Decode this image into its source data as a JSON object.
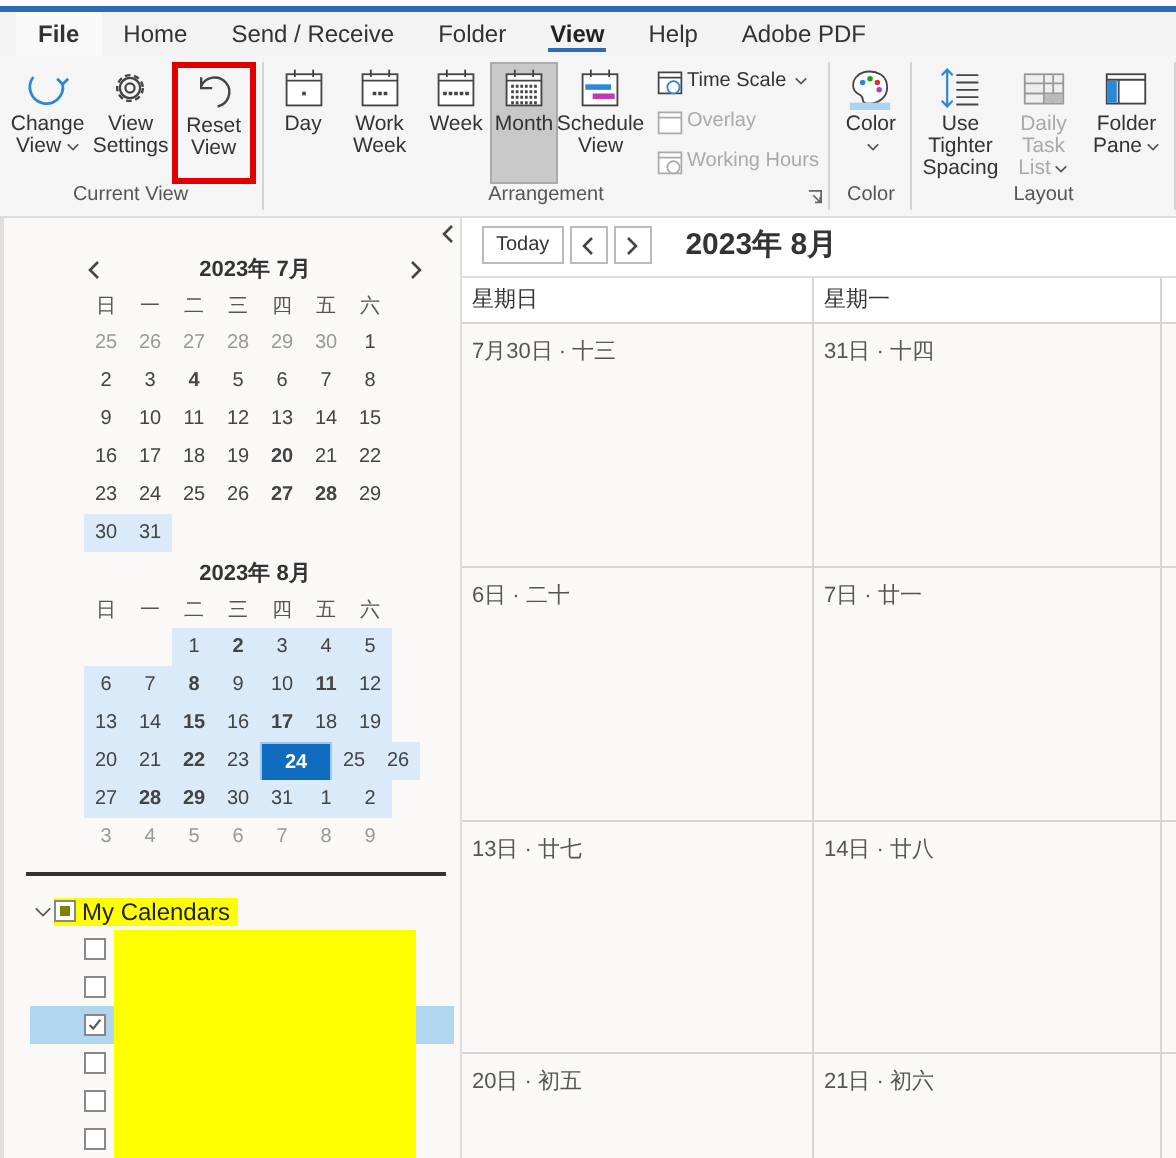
{
  "tabs": [
    {
      "label": "File",
      "selected": false
    },
    {
      "label": "Home",
      "selected": false
    },
    {
      "label": "Send / Receive",
      "selected": false
    },
    {
      "label": "Folder",
      "selected": false
    },
    {
      "label": "View",
      "selected": true
    },
    {
      "label": "Help",
      "selected": false
    },
    {
      "label": "Adobe PDF",
      "selected": false
    }
  ],
  "ribbon": [
    {
      "label": "Current View",
      "launcher": false,
      "buttons": [
        {
          "kind": "large",
          "label": "Change View",
          "dropdown": true,
          "selected": false,
          "disabled": false,
          "highlighted": false
        },
        {
          "kind": "large",
          "label": "View Settings",
          "dropdown": false,
          "selected": false,
          "disabled": false,
          "highlighted": false
        },
        {
          "kind": "large",
          "label": "Reset View",
          "dropdown": false,
          "selected": false,
          "disabled": false,
          "highlighted": true
        }
      ]
    },
    {
      "label": "Arrangement",
      "launcher": true,
      "buttons": [
        {
          "kind": "large",
          "label": "Day",
          "dropdown": false,
          "selected": false,
          "disabled": false,
          "highlighted": false
        },
        {
          "kind": "large",
          "label": "Work Week",
          "dropdown": false,
          "selected": false,
          "disabled": false,
          "highlighted": false
        },
        {
          "kind": "large",
          "label": "Week",
          "dropdown": false,
          "selected": false,
          "disabled": false,
          "highlighted": false
        },
        {
          "kind": "large",
          "label": "Month",
          "dropdown": false,
          "selected": true,
          "disabled": false,
          "highlighted": false
        },
        {
          "kind": "large",
          "label": "Schedule View",
          "dropdown": false,
          "selected": false,
          "disabled": false,
          "highlighted": false
        },
        {
          "kind": "small",
          "label": "Time Scale",
          "dropdown": true,
          "selected": false,
          "disabled": false,
          "highlighted": false
        },
        {
          "kind": "small",
          "label": "Overlay",
          "dropdown": false,
          "selected": false,
          "disabled": true,
          "highlighted": false
        },
        {
          "kind": "small",
          "label": "Working Hours",
          "dropdown": false,
          "selected": false,
          "disabled": true,
          "highlighted": false
        }
      ]
    },
    {
      "label": "Color",
      "launcher": false,
      "buttons": [
        {
          "kind": "large",
          "label": "Color",
          "dropdown": true,
          "selected": false,
          "disabled": false,
          "highlighted": false
        }
      ]
    },
    {
      "label": "Layout",
      "launcher": false,
      "buttons": [
        {
          "kind": "large",
          "label": "Use Tighter Spacing",
          "dropdown": false,
          "selected": false,
          "disabled": false,
          "highlighted": false
        },
        {
          "kind": "large",
          "label": "Daily Task List",
          "dropdown": true,
          "selected": false,
          "disabled": true,
          "highlighted": false
        },
        {
          "kind": "large",
          "label": "Folder Pane",
          "dropdown": true,
          "selected": false,
          "disabled": false,
          "highlighted": false
        }
      ]
    }
  ],
  "mini_calendars": [
    {
      "title": "2023年 7月",
      "weekdays": [
        "日",
        "一",
        "二",
        "三",
        "四",
        "五",
        "六"
      ],
      "weeks": [
        [
          {
            "kind": "day",
            "day": "25",
            "other": true,
            "bold": false,
            "selected": false,
            "today": false
          },
          {
            "kind": "day",
            "day": "26",
            "other": true,
            "bold": false,
            "selected": false,
            "today": false
          },
          {
            "kind": "day",
            "day": "27",
            "other": true,
            "bold": false,
            "selected": false,
            "today": false
          },
          {
            "kind": "day",
            "day": "28",
            "other": true,
            "bold": false,
            "selected": false,
            "today": false
          },
          {
            "kind": "day",
            "day": "29",
            "other": true,
            "bold": false,
            "selected": false,
            "today": false
          },
          {
            "kind": "day",
            "day": "30",
            "other": true,
            "bold": false,
            "selected": false,
            "today": false
          },
          {
            "kind": "day",
            "day": "1",
            "other": false,
            "bold": false,
            "selected": false,
            "today": false
          }
        ],
        [
          {
            "kind": "day",
            "day": "2",
            "other": false,
            "bold": false,
            "selected": false,
            "today": false
          },
          {
            "kind": "day",
            "day": "3",
            "other": false,
            "bold": false,
            "selected": false,
            "today": false
          },
          {
            "kind": "day",
            "day": "4",
            "other": false,
            "bold": true,
            "selected": false,
            "today": false
          },
          {
            "kind": "day",
            "day": "5",
            "other": false,
            "bold": false,
            "selected": false,
            "today": false
          },
          {
            "kind": "day",
            "day": "6",
            "other": false,
            "bold": false,
            "selected": false,
            "today": false
          },
          {
            "kind": "day",
            "day": "7",
            "other": false,
            "bold": false,
            "selected": false,
            "today": false
          },
          {
            "kind": "day",
            "day": "8",
            "other": false,
            "bold": false,
            "selected": false,
            "today": false
          }
        ],
        [
          {
            "kind": "day",
            "day": "9",
            "other": false,
            "bold": false,
            "selected": false,
            "today": false
          },
          {
            "kind": "day",
            "day": "10",
            "other": false,
            "bold": false,
            "selected": false,
            "today": false
          },
          {
            "kind": "day",
            "day": "11",
            "other": false,
            "bold": false,
            "selected": false,
            "today": false
          },
          {
            "kind": "day",
            "day": "12",
            "other": false,
            "bold": false,
            "selected": false,
            "today": false
          },
          {
            "kind": "day",
            "day": "13",
            "other": false,
            "bold": false,
            "selected": false,
            "today": false
          },
          {
            "kind": "day",
            "day": "14",
            "other": false,
            "bold": false,
            "selected": false,
            "today": false
          },
          {
            "kind": "day",
            "day": "15",
            "other": false,
            "bold": false,
            "selected": false,
            "today": false
          }
        ],
        [
          {
            "kind": "day",
            "day": "16",
            "other": false,
            "bold": false,
            "selected": false,
            "today": false
          },
          {
            "kind": "day",
            "day": "17",
            "other": false,
            "bold": false,
            "selected": false,
            "today": false
          },
          {
            "kind": "day",
            "day": "18",
            "other": false,
            "bold": false,
            "selected": false,
            "today": false
          },
          {
            "kind": "day",
            "day": "19",
            "other": false,
            "bold": false,
            "selected": false,
            "today": false
          },
          {
            "kind": "day",
            "day": "20",
            "other": false,
            "bold": true,
            "selected": false,
            "today": false
          },
          {
            "kind": "day",
            "day": "21",
            "other": false,
            "bold": false,
            "selected": false,
            "today": false
          },
          {
            "kind": "day",
            "day": "22",
            "other": false,
            "bold": false,
            "selected": false,
            "today": false
          }
        ],
        [
          {
            "kind": "day",
            "day": "23",
            "other": false,
            "bold": false,
            "selected": false,
            "today": false
          },
          {
            "kind": "day",
            "day": "24",
            "other": false,
            "bold": false,
            "selected": false,
            "today": false
          },
          {
            "kind": "day",
            "day": "25",
            "other": false,
            "bold": false,
            "selected": false,
            "today": false
          },
          {
            "kind": "day",
            "day": "26",
            "other": false,
            "bold": false,
            "selected": false,
            "today": false
          },
          {
            "kind": "day",
            "day": "27",
            "other": false,
            "bold": true,
            "selected": false,
            "today": false
          },
          {
            "kind": "day",
            "day": "28",
            "other": false,
            "bold": true,
            "selected": false,
            "today": false
          },
          {
            "kind": "day",
            "day": "29",
            "other": false,
            "bold": false,
            "selected": false,
            "today": false
          }
        ],
        [
          {
            "kind": "day",
            "day": "30",
            "other": false,
            "bold": false,
            "selected": true,
            "today": false
          },
          {
            "kind": "day",
            "day": "31",
            "other": false,
            "bold": false,
            "selected": true,
            "today": false
          }
        ]
      ]
    },
    {
      "title": "2023年 8月",
      "weekdays": [
        "日",
        "一",
        "二",
        "三",
        "四",
        "五",
        "六"
      ],
      "weeks": [
        [
          {
            "kind": "blank"
          },
          {
            "kind": "blank"
          },
          {
            "kind": "day",
            "day": "1",
            "other": false,
            "bold": false,
            "selected": true,
            "today": false
          },
          {
            "kind": "day",
            "day": "2",
            "other": false,
            "bold": true,
            "selected": true,
            "today": false
          },
          {
            "kind": "day",
            "day": "3",
            "other": false,
            "bold": false,
            "selected": true,
            "today": false
          },
          {
            "kind": "day",
            "day": "4",
            "other": false,
            "bold": false,
            "selected": true,
            "today": false
          },
          {
            "kind": "day",
            "day": "5",
            "other": false,
            "bold": false,
            "selected": true,
            "today": false
          }
        ],
        [
          {
            "kind": "day",
            "day": "6",
            "other": false,
            "bold": false,
            "selected": true,
            "today": false
          },
          {
            "kind": "day",
            "day": "7",
            "other": false,
            "bold": false,
            "selected": true,
            "today": false
          },
          {
            "kind": "day",
            "day": "8",
            "other": false,
            "bold": true,
            "selected": true,
            "today": false
          },
          {
            "kind": "day",
            "day": "9",
            "other": false,
            "bold": false,
            "selected": true,
            "today": false
          },
          {
            "kind": "day",
            "day": "10",
            "other": false,
            "bold": false,
            "selected": true,
            "today": false
          },
          {
            "kind": "day",
            "day": "11",
            "other": false,
            "bold": true,
            "selected": true,
            "today": false
          },
          {
            "kind": "day",
            "day": "12",
            "other": false,
            "bold": false,
            "selected": true,
            "today": false
          }
        ],
        [
          {
            "kind": "day",
            "day": "13",
            "other": false,
            "bold": false,
            "selected": true,
            "today": false
          },
          {
            "kind": "day",
            "day": "14",
            "other": false,
            "bold": false,
            "selected": true,
            "today": false
          },
          {
            "kind": "day",
            "day": "15",
            "other": false,
            "bold": true,
            "selected": true,
            "today": false
          },
          {
            "kind": "day",
            "day": "16",
            "other": false,
            "bold": false,
            "selected": true,
            "today": false
          },
          {
            "kind": "day",
            "day": "17",
            "other": false,
            "bold": true,
            "selected": true,
            "today": false
          },
          {
            "kind": "day",
            "day": "18",
            "other": false,
            "bold": false,
            "selected": true,
            "today": false
          },
          {
            "kind": "day",
            "day": "19",
            "other": false,
            "bold": false,
            "selected": true,
            "today": false
          }
        ],
        [
          {
            "kind": "day",
            "day": "20",
            "other": false,
            "bold": false,
            "selected": true,
            "today": false
          },
          {
            "kind": "day",
            "day": "21",
            "other": false,
            "bold": false,
            "selected": true,
            "today": false
          },
          {
            "kind": "day",
            "day": "22",
            "other": false,
            "bold": true,
            "selected": true,
            "today": false
          },
          {
            "kind": "day",
            "day": "23",
            "other": false,
            "bold": false,
            "selected": true,
            "today": false
          },
          {
            "kind": "day",
            "day": "24",
            "other": false,
            "bold": true,
            "selected": true,
            "today": true
          },
          {
            "kind": "day",
            "day": "25",
            "other": false,
            "bold": false,
            "selected": true,
            "today": false
          },
          {
            "kind": "day",
            "day": "26",
            "other": false,
            "bold": false,
            "selected": true,
            "today": false
          }
        ],
        [
          {
            "kind": "day",
            "day": "27",
            "other": false,
            "bold": false,
            "selected": true,
            "today": false
          },
          {
            "kind": "day",
            "day": "28",
            "other": false,
            "bold": true,
            "selected": true,
            "today": false
          },
          {
            "kind": "day",
            "day": "29",
            "other": false,
            "bold": true,
            "selected": true,
            "today": false
          },
          {
            "kind": "day",
            "day": "30",
            "other": false,
            "bold": false,
            "selected": true,
            "today": false
          },
          {
            "kind": "day",
            "day": "31",
            "other": false,
            "bold": false,
            "selected": true,
            "today": false
          },
          {
            "kind": "day",
            "day": "1",
            "other": false,
            "bold": false,
            "selected": true,
            "today": false
          },
          {
            "kind": "day",
            "day": "2",
            "other": false,
            "bold": false,
            "selected": true,
            "today": false
          }
        ],
        [
          {
            "kind": "day",
            "day": "3",
            "other": true,
            "bold": false,
            "selected": false,
            "today": false
          },
          {
            "kind": "day",
            "day": "4",
            "other": true,
            "bold": false,
            "selected": false,
            "today": false
          },
          {
            "kind": "day",
            "day": "5",
            "other": true,
            "bold": false,
            "selected": false,
            "today": false
          },
          {
            "kind": "day",
            "day": "6",
            "other": true,
            "bold": false,
            "selected": false,
            "today": false
          },
          {
            "kind": "day",
            "day": "7",
            "other": true,
            "bold": false,
            "selected": false,
            "today": false
          },
          {
            "kind": "day",
            "day": "8",
            "other": true,
            "bold": false,
            "selected": false,
            "today": false
          },
          {
            "kind": "day",
            "day": "9",
            "other": true,
            "bold": false,
            "selected": false,
            "today": false
          }
        ]
      ]
    }
  ],
  "calendar_tree": {
    "label": "My Calendars",
    "expanded": true,
    "partial": true,
    "highlighted": true,
    "items": [
      {
        "checked": false,
        "selected": false,
        "redacted": true
      },
      {
        "checked": false,
        "selected": false,
        "redacted": true
      },
      {
        "checked": true,
        "selected": true,
        "redacted": true
      },
      {
        "checked": false,
        "selected": false,
        "redacted": true
      },
      {
        "checked": false,
        "selected": false,
        "redacted": true
      },
      {
        "checked": false,
        "selected": false,
        "redacted": true
      }
    ]
  },
  "calendar": {
    "today_button": "Today",
    "title": "2023年 8月",
    "columns": [
      "星期日",
      "星期一"
    ],
    "rows": [
      [
        "7月30日 · 十三",
        "31日 · 十四"
      ],
      [
        "6日 · 二十",
        "7日 · 廿一"
      ],
      [
        "13日 · 廿七",
        "14日 · 廿八"
      ],
      [
        "20日 · 初五",
        "21日 · 初六"
      ]
    ]
  }
}
